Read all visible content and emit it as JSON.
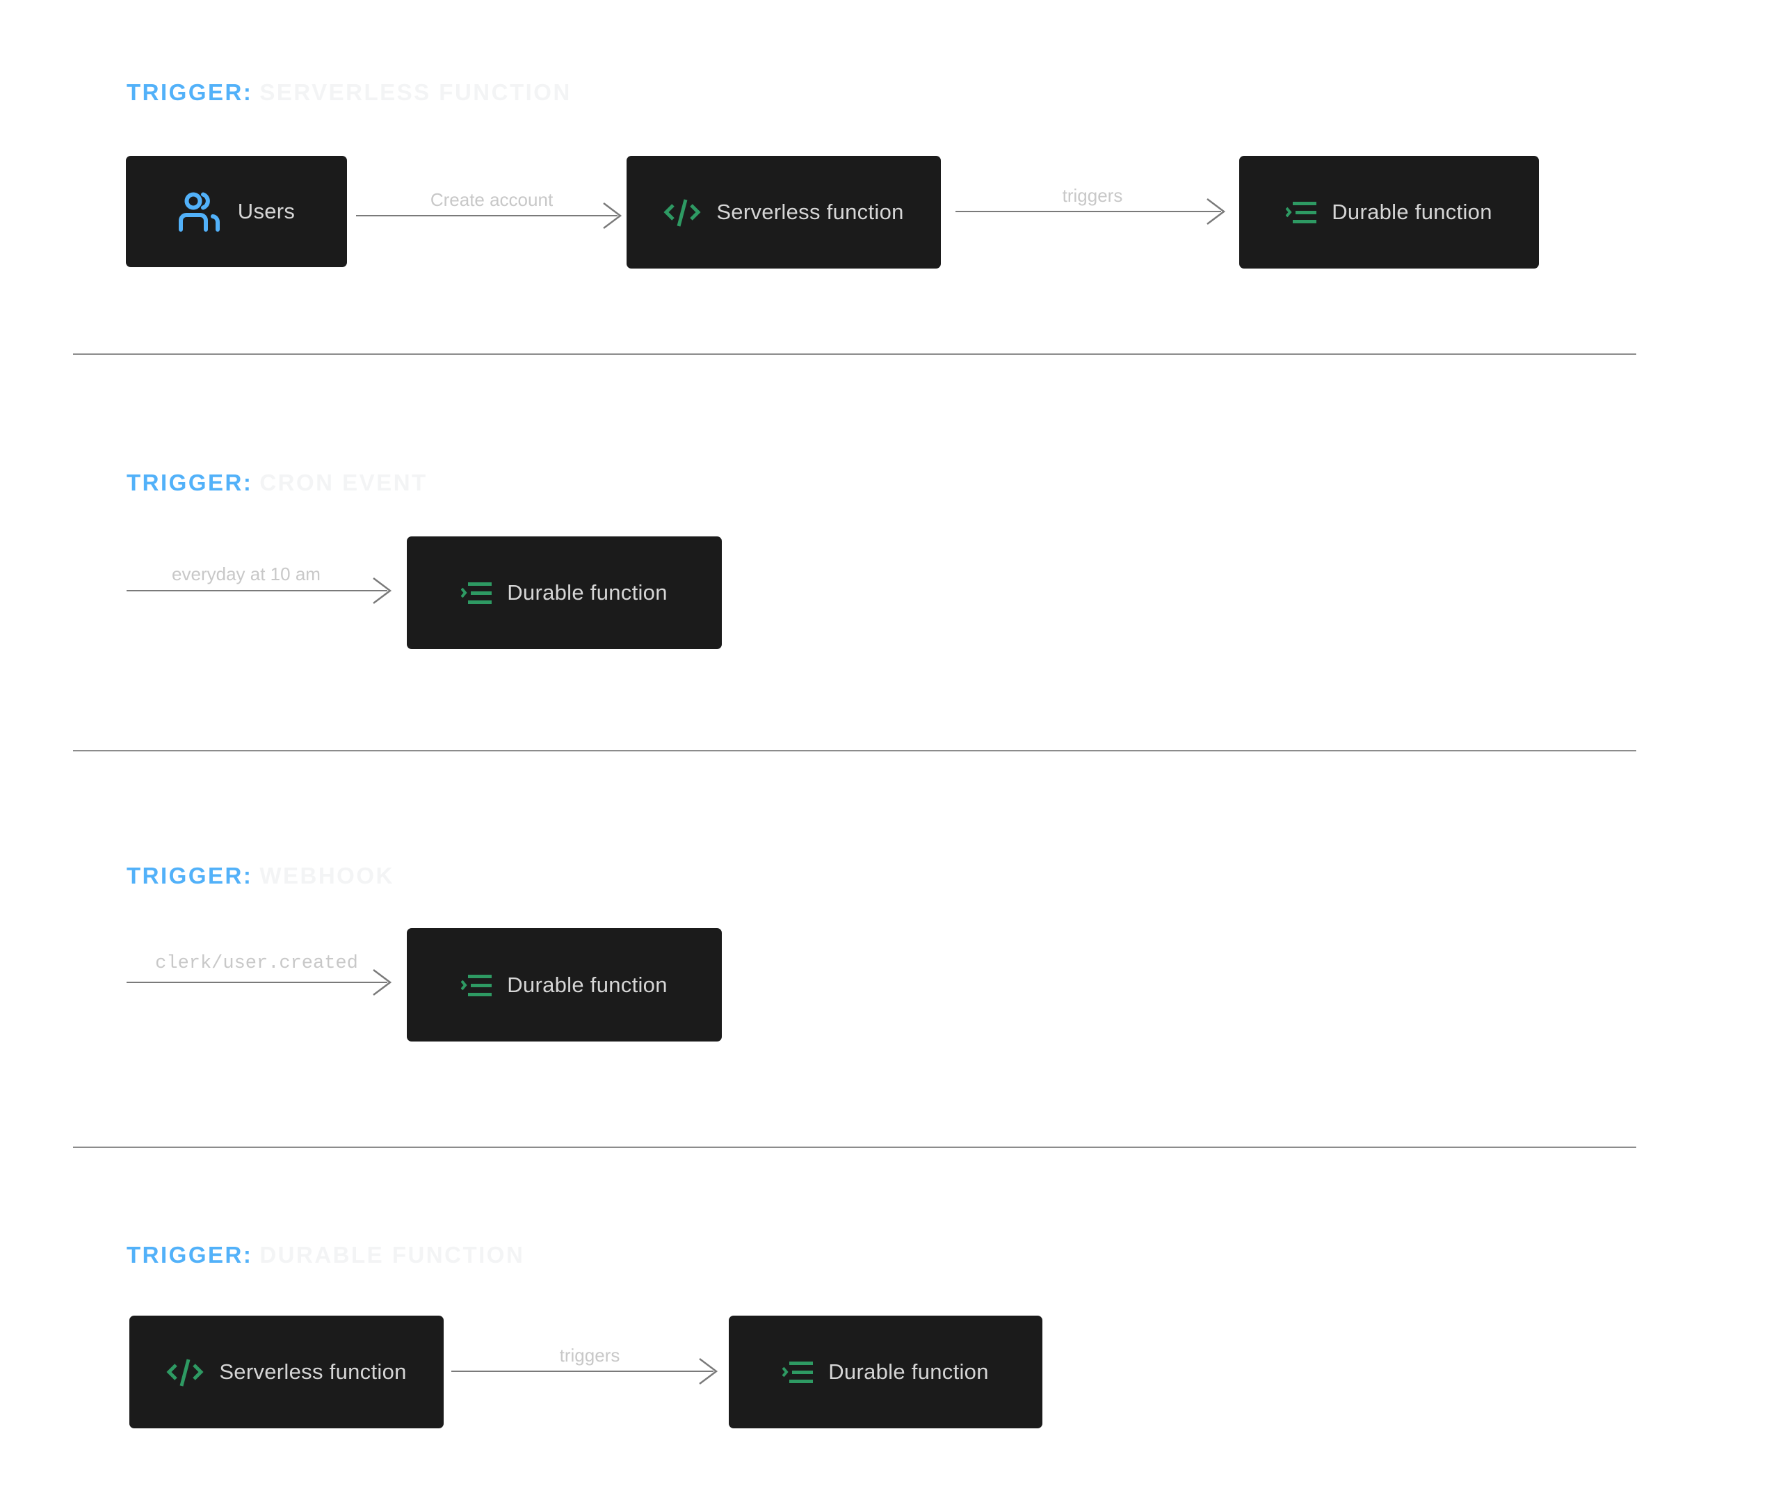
{
  "colors": {
    "accent_blue": "#52b1f9",
    "heading_suffix": "#f3f4f5",
    "node_bg": "#1b1b1b",
    "node_text": "#d6d6d6",
    "icon_green": "#2e9a63",
    "edge_line": "#7a7a7a",
    "edge_label": "#c8c8c8",
    "divider": "#8c8c8c"
  },
  "sections": [
    {
      "heading_prefix": "TRIGGER:",
      "heading_suffix": "SERVERLESS FUNCTION",
      "nodes": [
        {
          "label": "Users",
          "icon": "users-icon"
        },
        {
          "label": "Serverless function",
          "icon": "code-icon"
        },
        {
          "label": "Durable function",
          "icon": "durable-function-icon"
        }
      ],
      "edges": [
        {
          "from": "Users",
          "to": "Serverless function",
          "label": "Create account"
        },
        {
          "from": "Serverless function",
          "to": "Durable function",
          "label": "triggers"
        }
      ]
    },
    {
      "heading_prefix": "TRIGGER:",
      "heading_suffix": "CRON EVENT",
      "nodes": [
        {
          "label": "Durable function",
          "icon": "durable-function-icon"
        }
      ],
      "edges": [
        {
          "from": "",
          "to": "Durable function",
          "label": "everyday at 10 am"
        }
      ]
    },
    {
      "heading_prefix": "TRIGGER:",
      "heading_suffix": "WEBHOOK",
      "nodes": [
        {
          "label": "Durable function",
          "icon": "durable-function-icon"
        }
      ],
      "edges": [
        {
          "from": "",
          "to": "Durable function",
          "label": "clerk/user.created"
        }
      ]
    },
    {
      "heading_prefix": "TRIGGER:",
      "heading_suffix": "DURABLE FUNCTION",
      "nodes": [
        {
          "label": "Serverless function",
          "icon": "code-icon"
        },
        {
          "label": "Durable function",
          "icon": "durable-function-icon"
        }
      ],
      "edges": [
        {
          "from": "Serverless function",
          "to": "Durable function",
          "label": "triggers"
        }
      ]
    }
  ]
}
